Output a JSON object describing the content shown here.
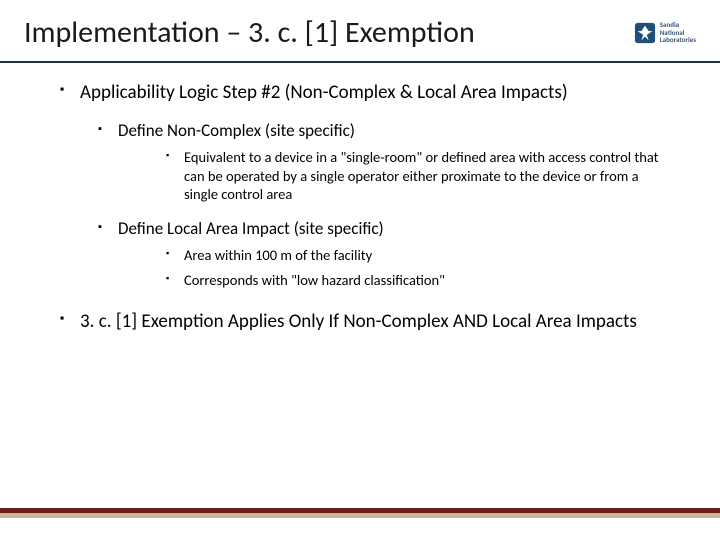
{
  "title": "Implementation – 3. c. [1] Exemption",
  "logo": {
    "line1": "Sandia",
    "line2": "National",
    "line3": "Laboratories"
  },
  "items": [
    {
      "text": "Applicability Logic Step #2 (Non-Complex & Local Area Impacts)",
      "children": [
        {
          "text": "Define Non-Complex (site specific)",
          "children": [
            {
              "text": "Equivalent to a device in a \"single-room\" or defined area with access control that can be operated by a single operator either proximate to the device or from a single control area"
            }
          ]
        },
        {
          "text": "Define Local Area Impact (site specific)",
          "children": [
            {
              "text": "Area within 100 m of the facility"
            },
            {
              "text": "Corresponds with \"low hazard classification\""
            }
          ]
        }
      ]
    },
    {
      "text": "3. c. [1] Exemption Applies Only If Non-Complex AND Local Area Impacts"
    }
  ]
}
